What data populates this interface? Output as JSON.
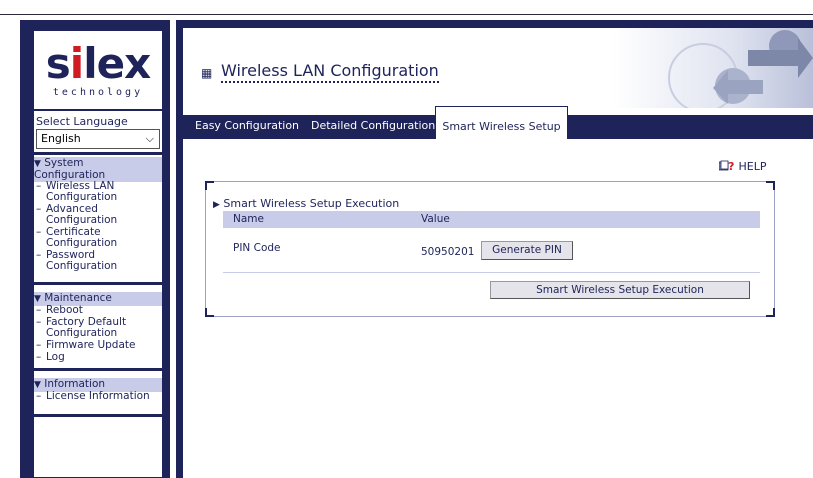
{
  "logo": {
    "word_before": "s",
    "word_i": "i",
    "word_after": "lex",
    "tagline": "technology"
  },
  "sidebar": {
    "language_label": "Select Language",
    "language_selected": "English",
    "sections": [
      {
        "title_line1": "System",
        "title_line2": "Configuration",
        "items": [
          {
            "line1": "Wireless LAN",
            "line2": "Configuration"
          },
          {
            "line1": "Advanced",
            "line2": "Configuration"
          },
          {
            "line1": "Certificate",
            "line2": "Configuration"
          },
          {
            "line1": "Password",
            "line2": "Configuration"
          }
        ]
      },
      {
        "title_line1": "Maintenance",
        "items": [
          {
            "line1": "Reboot"
          },
          {
            "line1": "Factory Default",
            "line2": "Configuration"
          },
          {
            "line1": "Firmware Update"
          },
          {
            "line1": "Log"
          }
        ]
      },
      {
        "title_line1": "Information",
        "items": [
          {
            "line1": "License Information"
          }
        ]
      }
    ]
  },
  "header": {
    "title": "Wireless LAN Configuration"
  },
  "tabs": [
    {
      "label": "Easy Configuration",
      "active": false
    },
    {
      "label": "Detailed Configuration",
      "active": false
    },
    {
      "label": "Smart Wireless Setup",
      "active": true
    }
  ],
  "help": {
    "label": "HELP"
  },
  "section": {
    "title": "Smart Wireless Setup Execution",
    "columns": [
      "Name",
      "Value"
    ],
    "row": {
      "name": "PIN Code",
      "value": "50950201",
      "button": "Generate PIN"
    },
    "execute_button": "Smart Wireless Setup Execution"
  },
  "colors": {
    "navy": "#1e2359",
    "lavender": "#c9cce8",
    "logo_red": "#d01a24"
  },
  "icons": [
    "chevron-down-icon",
    "triangle-down-icon",
    "bullet-square-icon",
    "help-book-icon",
    "play-triangle-icon"
  ]
}
